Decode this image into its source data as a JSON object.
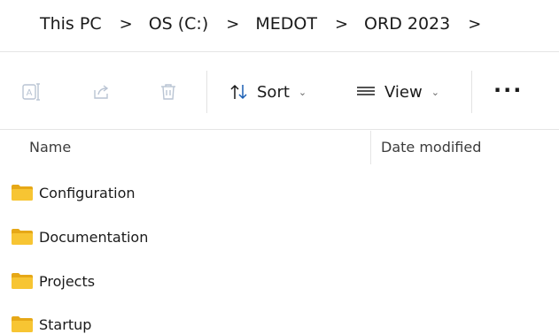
{
  "breadcrumb": {
    "items": [
      "This PC",
      "OS (C:)",
      "MEDOT",
      "ORD 2023"
    ],
    "separator": ">"
  },
  "toolbar": {
    "rename_icon": "rename-icon",
    "share_icon": "share-icon",
    "delete_icon": "trash-icon",
    "sort_label": "Sort",
    "view_label": "View",
    "more_label": "···"
  },
  "columns": {
    "name": "Name",
    "date_modified": "Date modified"
  },
  "files": [
    {
      "name": "Configuration",
      "type": "folder"
    },
    {
      "name": "Documentation",
      "type": "folder"
    },
    {
      "name": "Projects",
      "type": "folder"
    },
    {
      "name": "Startup",
      "type": "folder"
    }
  ],
  "colors": {
    "folder_front": "#f7c533",
    "folder_back": "#e6a817",
    "disabled_icon": "#b9c4d3",
    "accent": "#1a5fb4"
  }
}
